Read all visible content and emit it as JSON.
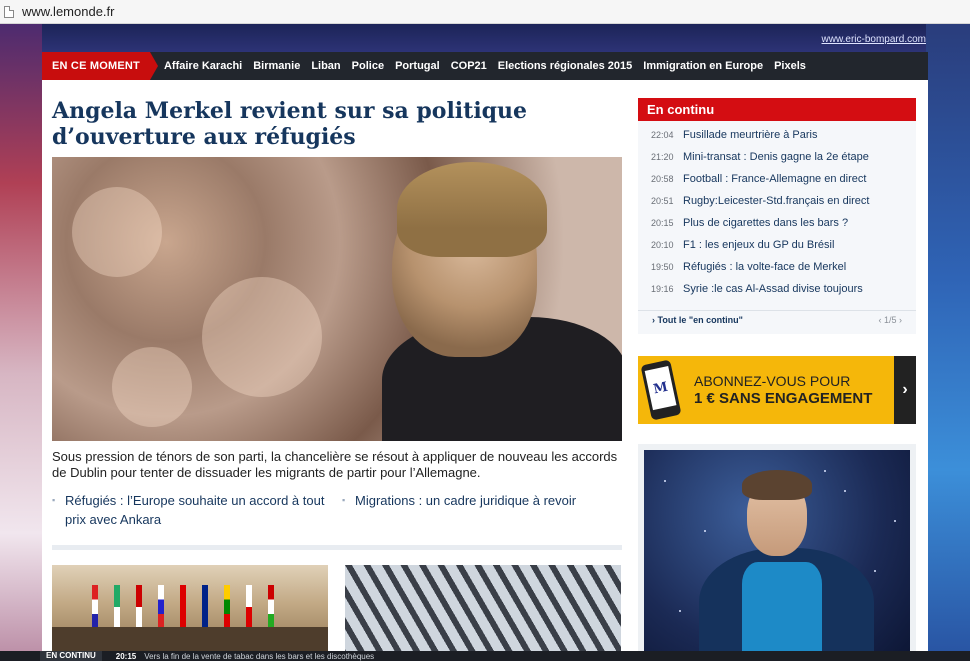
{
  "browser": {
    "url": "www.lemonde.fr"
  },
  "banner": {
    "link_text": "www.eric-bompard.com"
  },
  "nav": {
    "now_label": "EN CE MOMENT",
    "items": [
      "Affaire Karachi",
      "Birmanie",
      "Liban",
      "Police",
      "Portugal",
      "COP21",
      "Elections régionales 2015",
      "Immigration en Europe",
      "Pixels"
    ]
  },
  "article": {
    "headline": "Angela Merkel revient sur sa politique d’ouverture aux réfugiés",
    "lede": "Sous pression de ténors de son parti, la chancelière se résout à appliquer de nouveau les accords de Dublin pour tenter de dissuader les migrants de partir pour l’Allemagne.",
    "related": [
      "Réfugiés : l’Europe souhaite un accord à tout prix avec Ankara",
      "Migrations : un cadre juridique à revoir"
    ]
  },
  "en_continu": {
    "title": "En continu",
    "items": [
      {
        "time": "22:04",
        "text": "Fusillade meurtrière à Paris"
      },
      {
        "time": "21:20",
        "text": "Mini-transat : Denis gagne la 2e étape"
      },
      {
        "time": "20:58",
        "text": "Football : France-Allemagne en direct"
      },
      {
        "time": "20:51",
        "text": "Rugby:Leicester-Std.français en direct"
      },
      {
        "time": "20:15",
        "text": "Plus de cigarettes dans les bars ?"
      },
      {
        "time": "20:10",
        "text": "F1 : les enjeux du GP du Brésil"
      },
      {
        "time": "19:50",
        "text": "Réfugiés : la volte-face de Merkel"
      },
      {
        "time": "19:16",
        "text": "Syrie :le cas Al-Assad divise toujours"
      }
    ],
    "all_link": "› Tout le \"en continu\"",
    "pagination": "‹ 1/5 ›"
  },
  "promo": {
    "logo": "M",
    "line1": "ABONNEZ-VOUS POUR",
    "line2": "1 € SANS ENGAGEMENT",
    "arrow": "›"
  },
  "ticker": {
    "label": "EN CONTINU",
    "time": "20:15",
    "text": "Vers la fin de la vente de tabac dans les bars et les discothèques"
  },
  "colors": {
    "brand_red": "#c80d0d",
    "headline_blue": "#16365d",
    "nav_dark": "#22262d",
    "promo_yellow": "#f5b70a"
  }
}
